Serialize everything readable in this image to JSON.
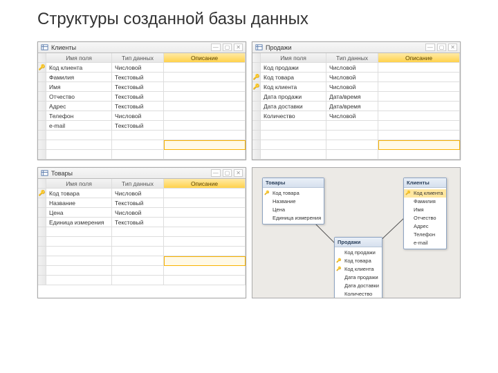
{
  "title": "Структуры созданной базы данных",
  "headers": {
    "field": "Имя поля",
    "type": "Тип данных",
    "desc": "Описание"
  },
  "tables": {
    "clients": {
      "tab": "Клиенты",
      "rows": [
        {
          "key": true,
          "field": "Код клиента",
          "type": "Числовой"
        },
        {
          "key": false,
          "field": "Фамилия",
          "type": "Текстовый"
        },
        {
          "key": false,
          "field": "Имя",
          "type": "Текстовый"
        },
        {
          "key": false,
          "field": "Отчество",
          "type": "Текстовый"
        },
        {
          "key": false,
          "field": "Адрес",
          "type": "Текстовый"
        },
        {
          "key": false,
          "field": "Телефон",
          "type": "Числовой"
        },
        {
          "key": false,
          "field": "e-mail",
          "type": "Текстовый"
        }
      ]
    },
    "sales": {
      "tab": "Продажи",
      "rows": [
        {
          "key": false,
          "field": "Код продажи",
          "type": "Числовой"
        },
        {
          "key": true,
          "field": "Код товара",
          "type": "Числовой"
        },
        {
          "key": true,
          "field": "Код клиента",
          "type": "Числовой"
        },
        {
          "key": false,
          "field": "Дата продажи",
          "type": "Дата/время"
        },
        {
          "key": false,
          "field": "Дата доставки",
          "type": "Дата/время"
        },
        {
          "key": false,
          "field": "Количество",
          "type": "Числовой"
        }
      ]
    },
    "goods": {
      "tab": "Товары",
      "rows": [
        {
          "key": true,
          "field": "Код товара",
          "type": "Числовой"
        },
        {
          "key": false,
          "field": "Название",
          "type": "Текстовый"
        },
        {
          "key": false,
          "field": "Цена",
          "type": "Числовой"
        },
        {
          "key": false,
          "field": "Единица измерения",
          "type": "Текстовый"
        }
      ]
    }
  },
  "rel": {
    "goods": {
      "title": "Товары",
      "fields": [
        "Код товара",
        "Название",
        "Цена",
        "Единица измерения"
      ]
    },
    "clients": {
      "title": "Клиенты",
      "fields": [
        "Код клиента",
        "Фамилия",
        "Имя",
        "Отчество",
        "Адрес",
        "Телефон",
        "e-mail"
      ]
    },
    "sales": {
      "title": "Продажи",
      "fields": [
        "Код продажи",
        "Код товара",
        "Код клиента",
        "Дата продажи",
        "Дата доставки",
        "Количество"
      ]
    }
  }
}
